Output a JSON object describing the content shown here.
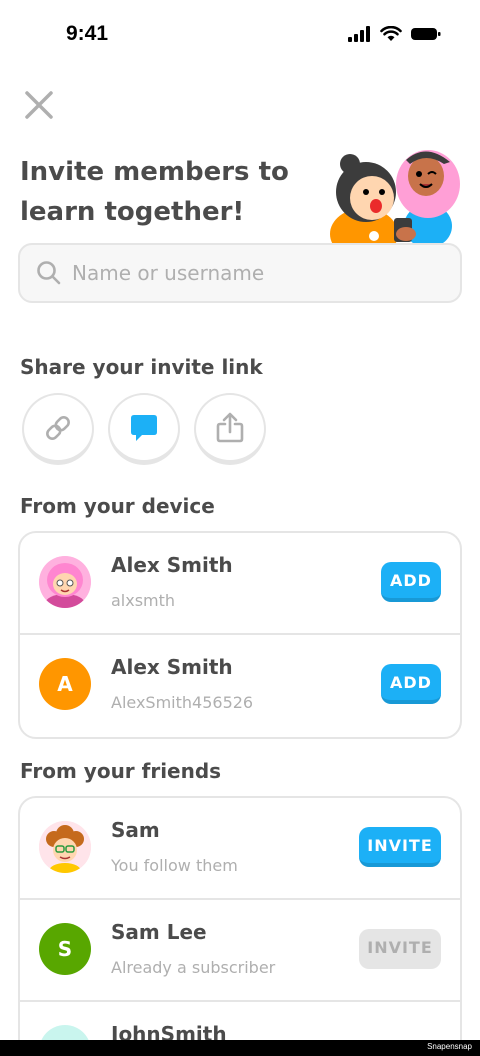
{
  "status_bar": {
    "time": "9:41"
  },
  "title": "Invite members to learn together!",
  "search": {
    "placeholder": "Name or username"
  },
  "share_section": {
    "title": "Share your invite link"
  },
  "device_section": {
    "title": "From your device",
    "contacts": [
      {
        "name": "Alex Smith",
        "username": "alxsmth",
        "button": "ADD",
        "avatar": "pink-hair-illustration"
      },
      {
        "name": "Alex Smith",
        "username": "AlexSmith456526",
        "button": "ADD",
        "avatar_letter": "A",
        "avatar_color": "#ff9600"
      }
    ]
  },
  "friends_section": {
    "title": "From your friends",
    "friends": [
      {
        "name": "Sam",
        "status": "You follow them",
        "button": "INVITE",
        "avatar": "curly-hair-illustration"
      },
      {
        "name": "Sam Lee",
        "status": "Already a subscriber",
        "button": "INVITE",
        "avatar_letter": "S",
        "avatar_color": "#58a700",
        "disabled": true
      },
      {
        "name": "JohnSmith"
      }
    ]
  },
  "colors": {
    "accent": "#1cb0f6",
    "text": "#4b4b4b",
    "muted": "#afafaf",
    "border": "#e5e5e5"
  },
  "watermark": "Snapensnap"
}
